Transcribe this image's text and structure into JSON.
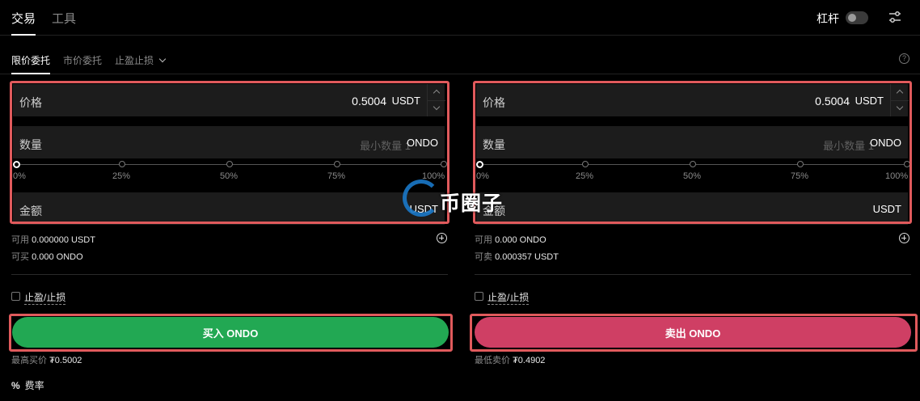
{
  "top_tabs": [
    "交易",
    "工具"
  ],
  "leverage_label": "杠杆",
  "order_tabs": {
    "limit": "限价委托",
    "market": "市价委托",
    "tpsl": "止盈止损"
  },
  "slider_labels": [
    "0%",
    "25%",
    "50%",
    "75%",
    "100%"
  ],
  "buy": {
    "price_label": "价格",
    "price_value": "0.5004",
    "price_unit": "USDT",
    "qty_label": "数量",
    "qty_placeholder": "最小数量 1",
    "qty_unit": "ONDO",
    "amount_label": "金额",
    "amount_unit": "USDT",
    "avail_label": "可用",
    "avail_value": "0.000000 USDT",
    "can_label": "可买",
    "can_value": "0.000 ONDO",
    "tpsl_label": "止盈/止损",
    "button_label": "买入 ONDO",
    "best_label": "最高买价",
    "best_value": "₮0.5002"
  },
  "sell": {
    "price_label": "价格",
    "price_value": "0.5004",
    "price_unit": "USDT",
    "qty_label": "数量",
    "qty_placeholder": "最小数量 1",
    "qty_unit": "ONDO",
    "amount_label": "金额",
    "amount_unit": "USDT",
    "avail_label": "可用",
    "avail_value": "0.000 ONDO",
    "can_label": "可卖",
    "can_value": "0.000357 USDT",
    "tpsl_label": "止盈/止损",
    "button_label": "卖出 ONDO",
    "best_label": "最低卖价",
    "best_value": "₮0.4902"
  },
  "fee": {
    "icon": "%",
    "label": "费率"
  },
  "watermark": "币圈子",
  "colors": {
    "buy": "#22a853",
    "sell": "#cf3f64",
    "highlight": "#e05a5c"
  }
}
